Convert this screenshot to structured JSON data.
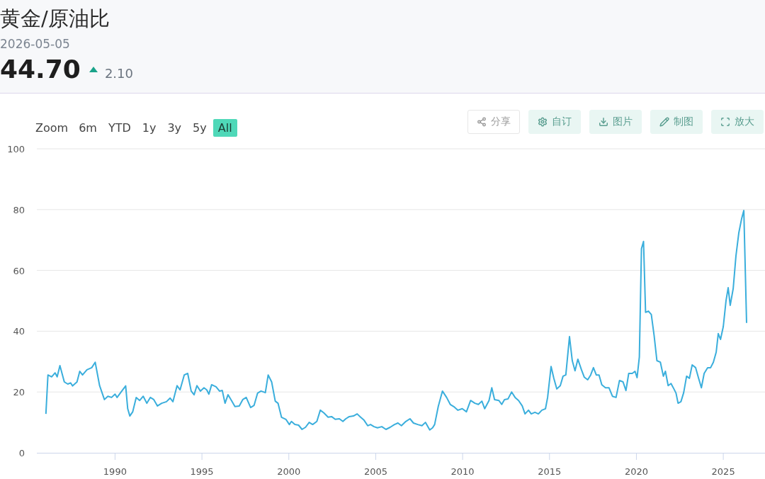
{
  "header": {
    "title": "黄金/原油比",
    "date": "2026-05-05",
    "value": "44.70",
    "change": "2.10",
    "rising": true
  },
  "range_selector": {
    "label": "Zoom",
    "options": [
      {
        "label": "6m",
        "selected": false
      },
      {
        "label": "YTD",
        "selected": false
      },
      {
        "label": "1y",
        "selected": false
      },
      {
        "label": "3y",
        "selected": false
      },
      {
        "label": "5y",
        "selected": false
      },
      {
        "label": "All",
        "selected": true
      }
    ]
  },
  "toolbar": [
    {
      "label": "分享",
      "kind": "outline"
    },
    {
      "label": "自订",
      "kind": "solid"
    },
    {
      "label": "图片",
      "kind": "solid"
    },
    {
      "label": "制图",
      "kind": "solid"
    },
    {
      "label": "放大",
      "kind": "solid"
    }
  ],
  "chart_data": {
    "type": "line",
    "grid": true,
    "xlim": [
      1985.5,
      2027.4
    ],
    "ylim": [
      0,
      100
    ],
    "yticks": [
      0,
      20,
      40,
      60,
      80,
      100
    ],
    "xticks": [
      1990,
      1995,
      2000,
      2005,
      2010,
      2015,
      2020,
      2025
    ],
    "x": [
      1986.02,
      1986.14,
      1986.35,
      1986.55,
      1986.67,
      1986.83,
      1987.08,
      1987.28,
      1987.44,
      1987.56,
      1987.81,
      1987.97,
      1988.13,
      1988.38,
      1988.66,
      1988.86,
      1989.11,
      1989.39,
      1989.59,
      1989.8,
      1990,
      1990.12,
      1990.41,
      1990.61,
      1990.73,
      1990.85,
      1991.02,
      1991.22,
      1991.42,
      1991.62,
      1991.83,
      1992.03,
      1992.23,
      1992.44,
      1992.68,
      1992.96,
      1993.17,
      1993.33,
      1993.57,
      1993.74,
      1993.98,
      1994.18,
      1994.38,
      1994.55,
      1994.71,
      1994.91,
      1995.12,
      1995.28,
      1995.4,
      1995.56,
      1995.81,
      1996.01,
      1996.17,
      1996.33,
      1996.5,
      1996.7,
      1996.9,
      1997.15,
      1997.35,
      1997.55,
      1997.8,
      1998,
      1998.2,
      1998.4,
      1998.65,
      1998.81,
      1999.01,
      1999.22,
      1999.38,
      1999.58,
      1999.83,
      2000.03,
      2000.15,
      2000.35,
      2000.56,
      2000.76,
      2000.96,
      2001.17,
      2001.37,
      2001.61,
      2001.81,
      2002.02,
      2002.26,
      2002.46,
      2002.67,
      2002.91,
      2003.11,
      2003.28,
      2003.48,
      2003.72,
      2003.93,
      2004.13,
      2004.33,
      2004.54,
      2004.7,
      2004.9,
      2005.1,
      2005.35,
      2005.59,
      2005.83,
      2006.08,
      2006.28,
      2006.48,
      2006.73,
      2006.97,
      2007.17,
      2007.42,
      2007.66,
      2007.86,
      2008.11,
      2008.27,
      2008.39,
      2008.6,
      2008.84,
      2009.08,
      2009.29,
      2009.49,
      2009.73,
      2009.98,
      2010.22,
      2010.46,
      2010.71,
      2010.91,
      2011.11,
      2011.27,
      2011.52,
      2011.68,
      2011.84,
      2012.09,
      2012.25,
      2012.41,
      2012.61,
      2012.82,
      2013.02,
      2013.22,
      2013.43,
      2013.59,
      2013.79,
      2013.95,
      2014.16,
      2014.36,
      2014.56,
      2014.77,
      2014.89,
      2015.09,
      2015.25,
      2015.42,
      2015.62,
      2015.78,
      2015.94,
      2016.15,
      2016.31,
      2016.47,
      2016.63,
      2016.84,
      2017,
      2017.2,
      2017.37,
      2017.53,
      2017.69,
      2017.85,
      2018.01,
      2018.22,
      2018.42,
      2018.62,
      2018.83,
      2019.03,
      2019.23,
      2019.4,
      2019.56,
      2019.76,
      2019.92,
      2020.04,
      2020.17,
      2020.29,
      2020.41,
      2020.53,
      2020.69,
      2020.86,
      2021.02,
      2021.18,
      2021.38,
      2021.55,
      2021.67,
      2021.83,
      2021.99,
      2022.16,
      2022.28,
      2022.4,
      2022.56,
      2022.72,
      2022.89,
      2023.05,
      2023.21,
      2023.41,
      2023.58,
      2023.74,
      2023.9,
      2024.1,
      2024.27,
      2024.43,
      2024.59,
      2024.71,
      2024.84,
      2025,
      2025.16,
      2025.28,
      2025.4,
      2025.57,
      2025.73,
      2025.89,
      2026.05,
      2026.18,
      2026.34
    ],
    "series": [
      {
        "color": "#3aaedc",
        "values": [
          12.8,
          25.6,
          25,
          26.3,
          25,
          28.7,
          23.3,
          22.6,
          23,
          22,
          23.3,
          26.8,
          25.6,
          27.3,
          28,
          29.8,
          22.1,
          17.5,
          18.6,
          18.2,
          19.3,
          18.2,
          20.5,
          22,
          14.5,
          12.1,
          13.5,
          18.2,
          17.2,
          18.6,
          16.3,
          18.2,
          17.5,
          15.4,
          16.3,
          16.8,
          18,
          16.8,
          22.1,
          20.7,
          25.6,
          26.1,
          20.3,
          19.1,
          22.1,
          20.3,
          21.4,
          20.7,
          19.3,
          22.4,
          21.7,
          20.3,
          20.5,
          16.3,
          19.1,
          17.2,
          15.2,
          15.4,
          17.5,
          18.2,
          14.9,
          15.6,
          19.6,
          20.3,
          19.8,
          25.6,
          23.3,
          17,
          16.3,
          11.7,
          11,
          9.3,
          10.3,
          9.3,
          9.1,
          7.7,
          8.4,
          10,
          9.3,
          10.3,
          14,
          13.1,
          11.7,
          11.9,
          11,
          11.2,
          10.3,
          11.2,
          11.9,
          12.1,
          12.8,
          11.7,
          10.7,
          8.9,
          9.3,
          8.6,
          8.2,
          8.6,
          7.7,
          8.4,
          9.3,
          9.8,
          8.9,
          10.3,
          11.2,
          9.8,
          9.3,
          8.9,
          10,
          7.5,
          8.2,
          9.3,
          15.2,
          20.3,
          18.2,
          15.9,
          15.2,
          14,
          14.5,
          13.5,
          17.2,
          16.3,
          15.9,
          17,
          14.5,
          17.2,
          21.4,
          17.5,
          17.2,
          15.9,
          17.5,
          17.7,
          20,
          18.2,
          17.2,
          15.4,
          12.8,
          14,
          12.8,
          13.3,
          12.8,
          14,
          14.5,
          18.2,
          28.4,
          24.5,
          21,
          22.1,
          25.2,
          25.6,
          38.2,
          30.3,
          27,
          30.8,
          27.3,
          24.9,
          24,
          25.6,
          28,
          25.6,
          25.6,
          22.4,
          21.4,
          21.4,
          18.6,
          18.2,
          23.8,
          23.3,
          20.5,
          26.1,
          26.1,
          26.8,
          24.7,
          31.5,
          67.1,
          69.5,
          46.2,
          46.6,
          45.5,
          38.5,
          30.3,
          29.8,
          25.2,
          26.8,
          22.1,
          22.8,
          21,
          19.6,
          16.3,
          16.8,
          19.8,
          25.2,
          24.5,
          28.9,
          28,
          24.5,
          21.4,
          26.1,
          28,
          28,
          29.8,
          33.1,
          39.2,
          37.3,
          41.5,
          50.1,
          54.3,
          48.5,
          54,
          64.8,
          72.3,
          76.9,
          79.7,
          42.7
        ]
      }
    ]
  }
}
